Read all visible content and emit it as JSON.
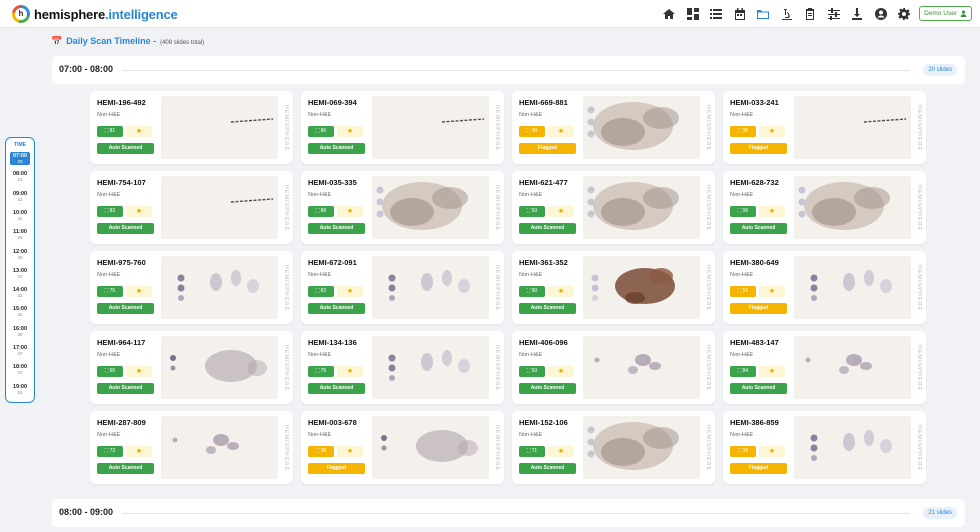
{
  "header": {
    "brand_part1": "hemisphere",
    "brand_part2": ".intelligence",
    "logo_letter": "h",
    "nav_icons": [
      "home-icon",
      "dashboard-icon",
      "list-icon",
      "calendar-icon",
      "folder-icon",
      "microscope-icon",
      "clipboard-icon",
      "sliders-icon",
      "download-icon",
      "account-circle-icon",
      "settings-icon"
    ],
    "active_nav": "folder-icon",
    "user_button": "Demo User"
  },
  "page": {
    "title": "Daily Scan Timeline -",
    "count": "(408 slides total)"
  },
  "time_rail": {
    "title": "TIME",
    "hours": [
      {
        "hour": "07:00",
        "count": "20",
        "selected": true
      },
      {
        "hour": "08:00",
        "count": "21"
      },
      {
        "hour": "09:00",
        "count": "41"
      },
      {
        "hour": "10:00",
        "count": "31"
      },
      {
        "hour": "11:00",
        "count": "25"
      },
      {
        "hour": "12:00",
        "count": "40"
      },
      {
        "hour": "13:00",
        "count": "37"
      },
      {
        "hour": "14:00",
        "count": "33"
      },
      {
        "hour": "15:00",
        "count": "32"
      },
      {
        "hour": "16:00",
        "count": "30"
      },
      {
        "hour": "17:00",
        "count": "47"
      },
      {
        "hour": "18:00",
        "count": "37"
      },
      {
        "hour": "19:00",
        "count": "15"
      }
    ]
  },
  "sections": [
    {
      "label": "07:00 - 08:00",
      "badge": "20 slides"
    },
    {
      "label": "08:00 - 09:00",
      "badge": "21 slides"
    }
  ],
  "watermark": "HEMISPHERE",
  "slides": [
    {
      "id": "HEMI-196-492",
      "type": "Non-H&E",
      "score": "81",
      "status": "Auto Scanned",
      "flagged": false,
      "thumb": "line"
    },
    {
      "id": "HEMI-069-394",
      "type": "Non-H&E",
      "score": "86",
      "status": "Auto Scanned",
      "flagged": false,
      "thumb": "line"
    },
    {
      "id": "HEMI-669-881",
      "type": "Non-H&E",
      "score": "49",
      "status": "Flagged",
      "flagged": true,
      "thumb": "tissue-large"
    },
    {
      "id": "HEMI-033-241",
      "type": "Non-H&E",
      "score": "36",
      "status": "Flagged",
      "flagged": true,
      "thumb": "line"
    },
    {
      "id": "HEMI-754-107",
      "type": "Non-H&E",
      "score": "83",
      "status": "Auto Scanned",
      "flagged": false,
      "thumb": "line"
    },
    {
      "id": "HEMI-035-335",
      "type": "Non-H&E",
      "score": "88",
      "status": "Auto Scanned",
      "flagged": false,
      "thumb": "tissue-large"
    },
    {
      "id": "HEMI-621-477",
      "type": "Non-H&E",
      "score": "93",
      "status": "Auto Scanned",
      "flagged": false,
      "thumb": "tissue-large"
    },
    {
      "id": "HEMI-628-732",
      "type": "Non-H&E",
      "score": "96",
      "status": "Auto Scanned",
      "flagged": false,
      "thumb": "tissue-large"
    },
    {
      "id": "HEMI-975-760",
      "type": "Non-H&E",
      "score": "75",
      "status": "Auto Scanned",
      "flagged": false,
      "thumb": "dots"
    },
    {
      "id": "HEMI-672-091",
      "type": "Non-H&E",
      "score": "83",
      "status": "Auto Scanned",
      "flagged": false,
      "thumb": "dots"
    },
    {
      "id": "HEMI-361-352",
      "type": "Non-H&E",
      "score": "90",
      "status": "Auto Scanned",
      "flagged": false,
      "thumb": "brown"
    },
    {
      "id": "HEMI-380-649",
      "type": "Non-H&E",
      "score": "53",
      "status": "Flagged",
      "flagged": true,
      "thumb": "dots"
    },
    {
      "id": "HEMI-964-117",
      "type": "Non-H&E",
      "score": "65",
      "status": "Auto Scanned",
      "flagged": false,
      "thumb": "tissue-medium"
    },
    {
      "id": "HEMI-134-136",
      "type": "Non-H&E",
      "score": "75",
      "status": "Auto Scanned",
      "flagged": false,
      "thumb": "dots"
    },
    {
      "id": "HEMI-406-096",
      "type": "Non-H&E",
      "score": "93",
      "status": "Auto Scanned",
      "flagged": false,
      "thumb": "small"
    },
    {
      "id": "HEMI-483-147",
      "type": "Non-H&E",
      "score": "84",
      "status": "Auto Scanned",
      "flagged": false,
      "thumb": "small"
    },
    {
      "id": "HEMI-287-809",
      "type": "Non-H&E",
      "score": "73",
      "status": "Auto Scanned",
      "flagged": false,
      "thumb": "small"
    },
    {
      "id": "HEMI-003-678",
      "type": "Non-H&E",
      "score": "36",
      "status": "Flagged",
      "flagged": true,
      "thumb": "tissue-medium"
    },
    {
      "id": "HEMI-152-106",
      "type": "Non-H&E",
      "score": "71",
      "status": "Auto Scanned",
      "flagged": false,
      "thumb": "tissue-large"
    },
    {
      "id": "HEMI-386-859",
      "type": "Non-H&E",
      "score": "39",
      "status": "Flagged",
      "flagged": true,
      "thumb": "dots"
    }
  ]
}
